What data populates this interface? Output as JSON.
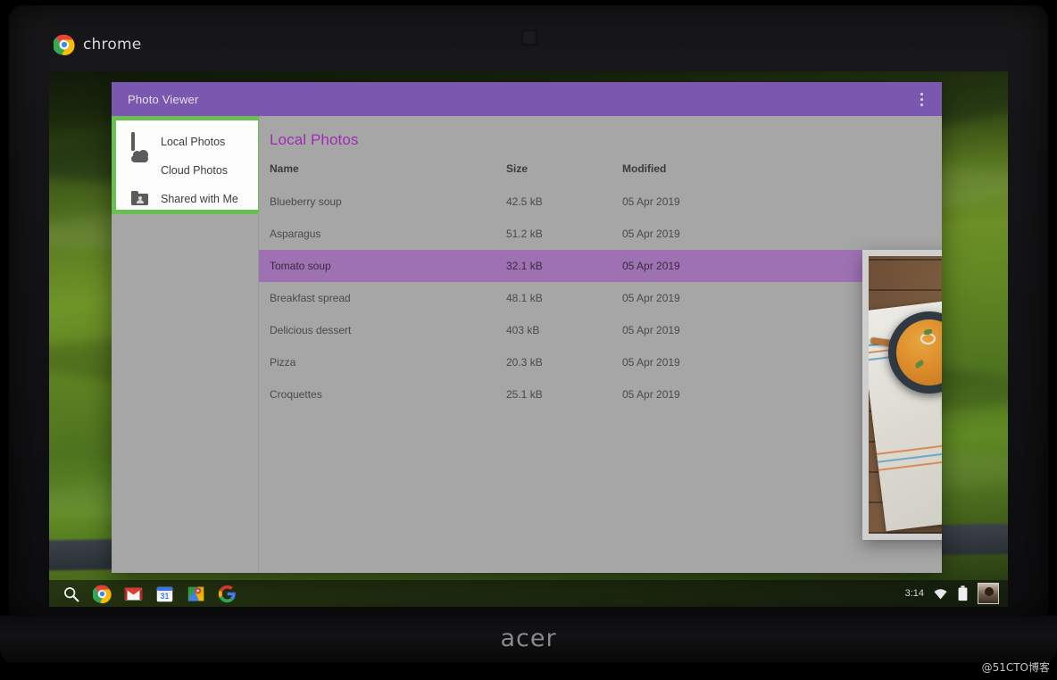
{
  "device": {
    "brand": "acer",
    "os_brand": "chrome",
    "chrome_logo_icon": "chrome-logo-icon",
    "webcam_icon": "webcam-icon"
  },
  "shelf": {
    "time": "3:14",
    "launcher_icon": "search-icon",
    "apps": [
      {
        "icon": "chrome-icon",
        "label": "Chrome"
      },
      {
        "icon": "gmail-icon",
        "label": "Gmail"
      },
      {
        "icon": "calendar-icon",
        "label": "Calendar",
        "day": "31"
      },
      {
        "icon": "maps-icon",
        "label": "Maps"
      },
      {
        "icon": "google-icon",
        "label": "Google Search"
      }
    ],
    "status": {
      "wifi_icon": "wifi-icon",
      "battery_icon": "battery-icon",
      "avatar_icon": "avatar"
    }
  },
  "app": {
    "title": "Photo Viewer",
    "overflow_icon": "more-vert-icon",
    "page_title": "Local Photos",
    "colors": {
      "app_bar": "#7a58b0",
      "accent_title": "#a02bb4",
      "selected_row": "#9e72b2",
      "content_bg": "#a6a6a6",
      "highlight_border": "#6abf52"
    }
  },
  "drawer": {
    "highlighted": true,
    "items": [
      {
        "label": "Local Photos",
        "icon": "photo-icon",
        "selected": true
      },
      {
        "label": "Cloud Photos",
        "icon": "cloud-icon",
        "selected": false
      },
      {
        "label": "Shared with Me",
        "icon": "folder-shared-icon",
        "selected": false
      }
    ]
  },
  "table": {
    "columns": [
      "Name",
      "Size",
      "Modified"
    ],
    "rows": [
      {
        "name": "Blueberry soup",
        "size": "42.5 kB",
        "modified": "05 Apr 2019",
        "selected": false
      },
      {
        "name": "Asparagus",
        "size": "51.2 kB",
        "modified": "05 Apr 2019",
        "selected": false
      },
      {
        "name": "Tomato soup",
        "size": "32.1 kB",
        "modified": "05 Apr 2019",
        "selected": true
      },
      {
        "name": "Breakfast spread",
        "size": "48.1 kB",
        "modified": "05 Apr 2019",
        "selected": false
      },
      {
        "name": "Delicious dessert",
        "size": "403 kB",
        "modified": "05 Apr 2019",
        "selected": false
      },
      {
        "name": "Pizza",
        "size": "20.3 kB",
        "modified": "05 Apr 2019",
        "selected": false
      },
      {
        "name": "Croquettes",
        "size": "25.1 kB",
        "modified": "05 Apr 2019",
        "selected": false
      }
    ]
  },
  "preview": {
    "name": "preview-photo",
    "alt": "Two bowls of tomato soup on a wooden table with a striped cloth"
  },
  "watermark": {
    "text": "@51CTO博客"
  }
}
